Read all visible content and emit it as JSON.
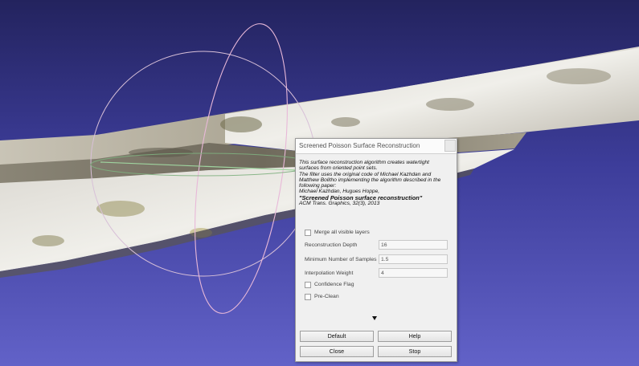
{
  "dialog": {
    "title": "Screened Poisson Surface Reconstruction",
    "description": [
      "This surface reconstruction algorithm creates watertight",
      "surfaces from oriented point sets.",
      "The filter uses the original code of Michael Kazhdan and",
      "Matthew Bolitho implementing the algorithm described in the",
      "following paper:",
      "Michael Kazhdan, Hugues Hoppe,",
      "\"Screened Poisson surface reconstruction\"",
      "ACM Trans. Graphics, 32(3), 2013"
    ],
    "merge_layers_label": "Merge all visible layers",
    "reconstruction_depth_label": "Reconstruction Depth",
    "reconstruction_depth_value": "16",
    "min_samples_label": "Minimum Number of Samples",
    "min_samples_value": "1.5",
    "interpolation_weight_label": "Interpolation Weight",
    "interpolation_weight_value": "4",
    "confidence_flag_label": "Confidence Flag",
    "pre_clean_label": "Pre-Clean",
    "buttons": {
      "default": "Default",
      "help": "Help",
      "close": "Close",
      "stop": "Stop"
    }
  },
  "colors": {
    "background_top": "#23235e",
    "background_bottom": "#6262c8",
    "trackball_circle": "#d8c0d8",
    "dialog_bg": "#f0f0f0"
  },
  "icons": {
    "expand": "triangle-down-icon"
  }
}
